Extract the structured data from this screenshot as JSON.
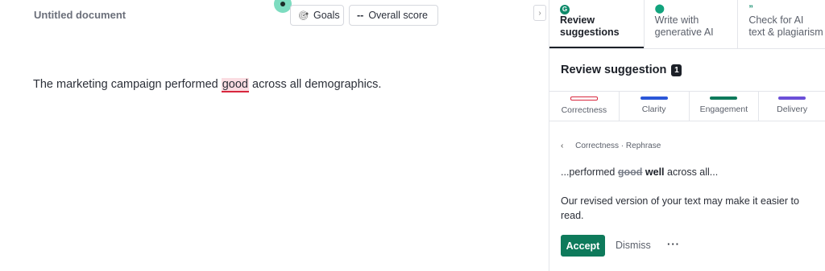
{
  "document": {
    "title": "Untitled document",
    "text_before": "The marketing campaign performed ",
    "flagged_word": "good",
    "text_after": " across all demographics."
  },
  "toolbar": {
    "goals_icon": "target-icon",
    "goals_label": "Goals",
    "score_prefix": "--",
    "score_label": "Overall score"
  },
  "panel": {
    "tabs": [
      {
        "line1": "Review",
        "line2": "suggestions",
        "icon": "grammarly-g-icon"
      },
      {
        "line1": "Write with",
        "line2": "generative AI",
        "icon": "lightbulb-pin-icon"
      },
      {
        "line1": "Check for AI",
        "line2": "text & plagiarism",
        "icon": "quote-icon"
      }
    ],
    "header": {
      "title": "Review suggestion",
      "count": "1"
    },
    "categories": [
      {
        "label": "Correctness",
        "color": "#d8273e"
      },
      {
        "label": "Clarity",
        "color": "#2b57d8"
      },
      {
        "label": "Engagement",
        "color": "#0e7a5b"
      },
      {
        "label": "Delivery",
        "color": "#6b4fd8"
      }
    ],
    "suggestion": {
      "breadcrumb": "Correctness · Rephrase",
      "prefix": "...performed ",
      "removed": "good",
      "added": "well",
      "suffix": " across all...",
      "explanation": "Our revised version of your text may make it easier to read.",
      "accept_label": "Accept",
      "dismiss_label": "Dismiss",
      "more_label": "···"
    }
  }
}
